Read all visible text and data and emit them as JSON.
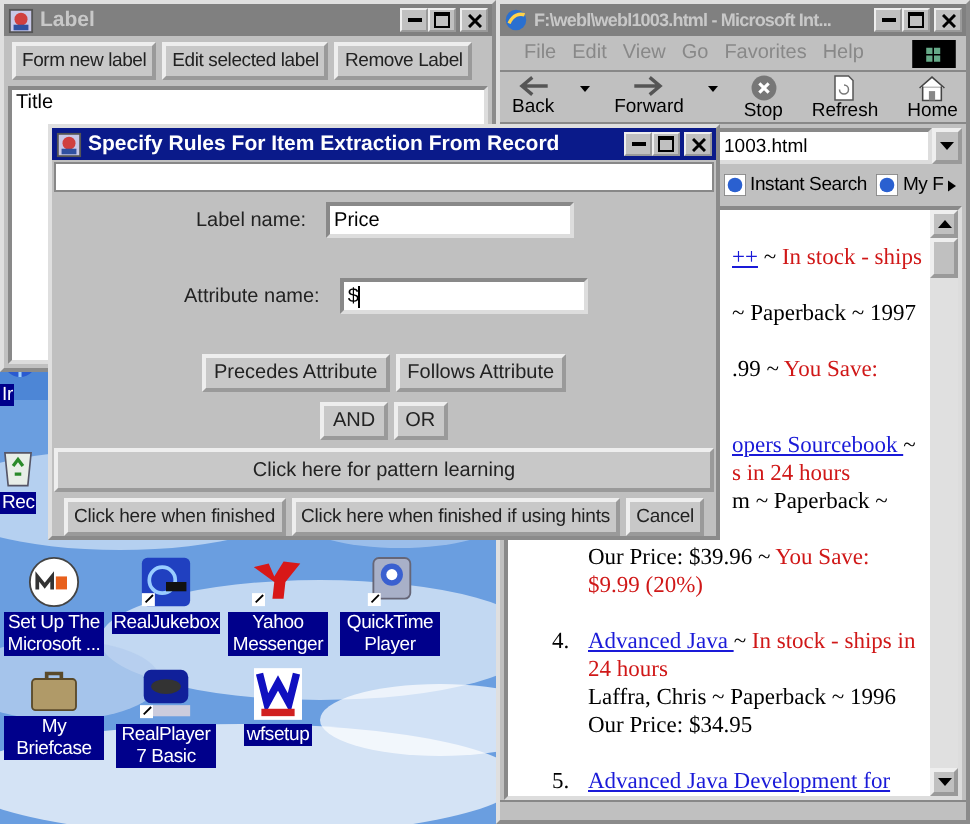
{
  "desktop": {
    "icons": [
      {
        "label": "Ir",
        "kind": "ie"
      },
      {
        "label": "Rec",
        "kind": "recycle"
      },
      {
        "label": "Set Up The Microsoft ...",
        "kind": "msn"
      },
      {
        "label": "RealJukebox",
        "kind": "jukebox"
      },
      {
        "label": "Yahoo Messenger",
        "kind": "yahoo"
      },
      {
        "label": "QuickTime Player",
        "kind": "quicktime"
      },
      {
        "label": "My Briefcase",
        "kind": "briefcase"
      },
      {
        "label": "RealPlayer 7 Basic",
        "kind": "realplayer"
      },
      {
        "label": "wfsetup",
        "kind": "wfsetup"
      }
    ]
  },
  "label_window": {
    "title": "Label",
    "buttons": [
      "Form new label",
      "Edit selected label",
      "Remove Label"
    ],
    "list_items": [
      "Title"
    ]
  },
  "browser": {
    "title": "F:\\webl\\webl1003.html - Microsoft Int...",
    "menu": [
      "File",
      "Edit",
      "View",
      "Go",
      "Favorites",
      "Help"
    ],
    "toolbar": [
      {
        "label": "Back",
        "kind": "back"
      },
      {
        "label": "Forward",
        "kind": "forward"
      },
      {
        "label": "Stop",
        "kind": "stop"
      },
      {
        "label": "Refresh",
        "kind": "refresh"
      },
      {
        "label": "Home",
        "kind": "home"
      }
    ],
    "address": "1003.html",
    "links": [
      "Instant Search",
      "My F"
    ],
    "content": [
      {
        "kind": "fragment",
        "lines": [
          [
            {
              "kind": "link",
              "text": "++"
            },
            {
              "kind": "text",
              "text": " ~ "
            },
            {
              "kind": "stock",
              "text": "In stock - ships"
            }
          ]
        ]
      },
      {
        "kind": "fragment",
        "lines": [
          [
            {
              "kind": "text",
              "text": "~ Paperback ~ 1997"
            }
          ]
        ]
      },
      {
        "kind": "fragment",
        "lines": [
          [
            {
              "kind": "text",
              "text": ".99 ~ "
            },
            {
              "kind": "stock",
              "text": "You Save:"
            }
          ]
        ]
      },
      {
        "kind": "fragment",
        "lines": [
          [
            {
              "kind": "link",
              "text": "opers Sourcebook "
            },
            {
              "kind": "text",
              "text": "~"
            }
          ],
          [
            {
              "kind": "stock",
              "text": "s in 24 hours"
            }
          ],
          [
            {
              "kind": "text",
              "text": "m ~ Paperback ~"
            }
          ]
        ]
      },
      {
        "kind": "continued",
        "lines": [
          [
            {
              "kind": "text",
              "text": "Our Price: $39.96 ~ "
            },
            {
              "kind": "stock",
              "text": "You Save: $9.99 (20%)"
            }
          ]
        ]
      },
      {
        "kind": "item",
        "number": "4.",
        "lines": [
          [
            {
              "kind": "link",
              "text": "Advanced Java "
            },
            {
              "kind": "text",
              "text": "~ "
            },
            {
              "kind": "stock",
              "text": "In stock - ships in 24 hours"
            }
          ],
          [
            {
              "kind": "text",
              "text": "Laffra, Chris ~ Paperback ~ 1996"
            }
          ],
          [
            {
              "kind": "text",
              "text": "Our Price: $34.95"
            }
          ]
        ]
      },
      {
        "kind": "item",
        "number": "5.",
        "lines": [
          [
            {
              "kind": "link",
              "text": "Advanced Java Development for"
            }
          ]
        ]
      }
    ]
  },
  "dialog": {
    "title": "Specify Rules For Item Extraction From Record",
    "fields": [
      {
        "label": "Label name:",
        "value": "Price"
      },
      {
        "label": "Attribute name:",
        "value": "$"
      }
    ],
    "position_buttons": [
      "Precedes Attribute",
      "Follows Attribute"
    ],
    "logic_buttons": [
      "AND",
      "OR"
    ],
    "pattern_button": "Click here for pattern learning",
    "bottom_buttons": [
      "Click here when finished",
      "Click here when finished if using hints",
      "Cancel"
    ]
  }
}
